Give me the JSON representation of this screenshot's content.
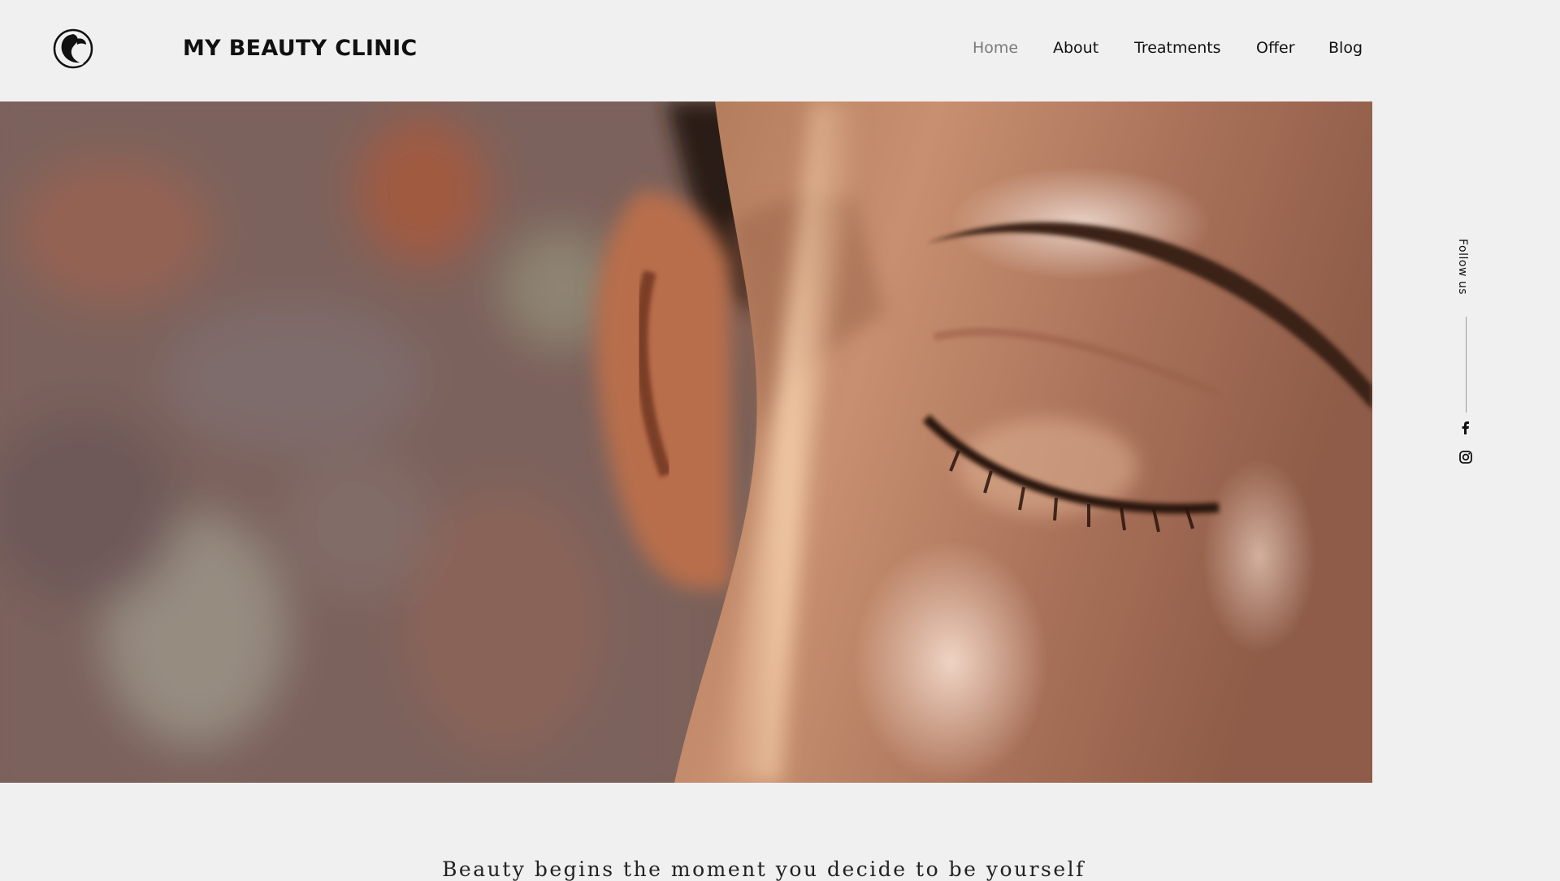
{
  "header": {
    "logo_icon": "woman-profile-logo-icon",
    "brand": "MY BEAUTY CLINIC"
  },
  "nav": {
    "items": [
      {
        "label": "Home",
        "active": true
      },
      {
        "label": "About",
        "active": false
      },
      {
        "label": "Treatments",
        "active": false
      },
      {
        "label": "Offer",
        "active": false
      },
      {
        "label": "Blog",
        "active": false
      }
    ]
  },
  "hero": {
    "image": "close-up-face-closed-eye-photo"
  },
  "social": {
    "follow_label": "Follow us",
    "icons": [
      "facebook-icon",
      "instagram-icon"
    ]
  },
  "main": {
    "tagline": "Beauty begins the moment you decide to be yourself"
  },
  "colors": {
    "background": "#f0f0f0",
    "text": "#111111",
    "nav_active": "#7a7a7a"
  }
}
